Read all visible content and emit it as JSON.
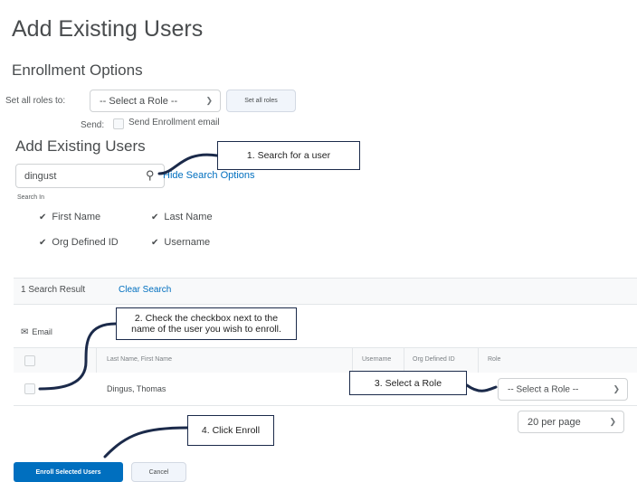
{
  "page": {
    "title": "Add Existing Users"
  },
  "enrollment": {
    "heading": "Enrollment Options",
    "set_all_roles_label": "Set all roles to:",
    "role_select_value": "-- Select a Role --",
    "set_all_roles_button": "Set all roles",
    "send_label": "Send:",
    "send_email_label": "Send Enrollment email"
  },
  "search": {
    "heading": "Add Existing Users",
    "value": "dingust",
    "hide_options_link": "Hide Search Options",
    "search_in_label": "Search In",
    "options": [
      {
        "label": "First Name",
        "checked": true
      },
      {
        "label": "Last Name",
        "checked": true
      },
      {
        "label": "Org Defined ID",
        "checked": true
      },
      {
        "label": "Username",
        "checked": true
      }
    ]
  },
  "results": {
    "count_text": "1 Search Result",
    "clear_link": "Clear Search",
    "email_label": "Email",
    "columns": [
      "Last Name, First Name",
      "Username",
      "Org Defined ID",
      "Role"
    ],
    "rows": [
      {
        "name": "Dingus, Thomas",
        "username": "",
        "org_id": "",
        "role": "-- Select a Role --"
      }
    ],
    "per_page": "20 per page"
  },
  "actions": {
    "enroll_button": "Enroll Selected Users",
    "cancel_button": "Cancel"
  },
  "callouts": {
    "c1": "1. Search for a user",
    "c2": "2. Check the checkbox next to the name of the user you wish to enroll.",
    "c3": "3. Select a Role",
    "c4": "4. Click Enroll"
  },
  "colors": {
    "primary": "#006fbf",
    "link": "#006fbf",
    "callout_border": "#1b2a4a"
  }
}
